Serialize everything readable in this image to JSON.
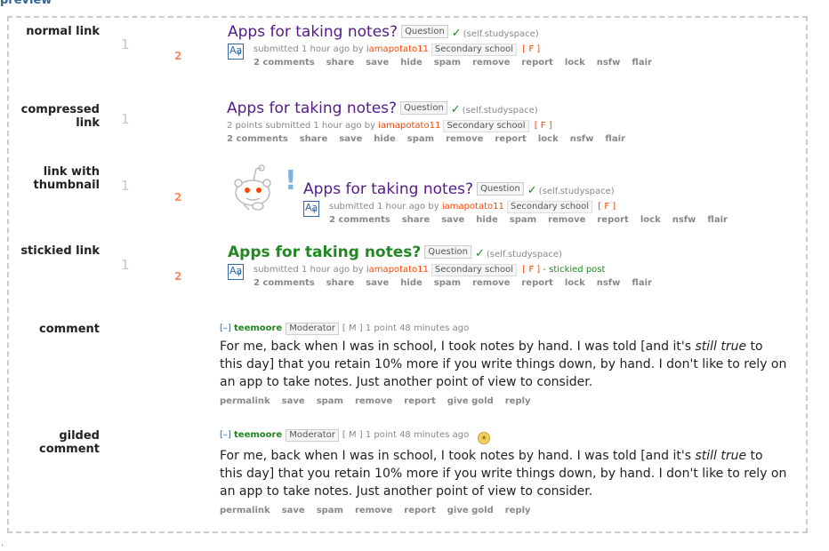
{
  "preview_heading": "preview",
  "post": {
    "title": "Apps for taking notes?",
    "flair": "Question",
    "check": "✓",
    "domain": "(self.studyspace)",
    "submitted_prefix": "submitted",
    "time": "1 hour ago",
    "by": "by",
    "author": "iamapotato11",
    "user_flair": "Secondary school",
    "f_box": "[ F ]",
    "points_prefix": "2 points submitted",
    "stickied_suffix": "- stickied post",
    "vote_a": "1",
    "vote_b": "2",
    "aa_icon": "Aa",
    "aa_plus": "+",
    "buttons": {
      "comments": "2 comments",
      "share": "share",
      "save": "save",
      "hide": "hide",
      "spam": "spam",
      "remove": "remove",
      "report": "report",
      "lock": "lock",
      "nsfw": "nsfw",
      "flair": "flair"
    },
    "exclaim": "!"
  },
  "rows": {
    "normal": "normal link",
    "compressed": "compressed link",
    "thumbnail": "link with thumbnail",
    "stickied": "stickied link",
    "comment": "comment",
    "gilded": "gilded comment"
  },
  "comment": {
    "toggle": "[–]",
    "author": "teemoore",
    "badge": "Moderator",
    "m_box": "[ M ]",
    "score": "1 point 48 minutes ago",
    "body_start": "For me, back when I was in school, I took notes by hand. I was told [and it's ",
    "body_italic": "still true",
    "body_end": " to this day] that you retain 10% more if you write things down, by hand. I don't like to rely on an app to take notes. Just another point of view to consider.",
    "buttons": {
      "permalink": "permalink",
      "save": "save",
      "spam": "spam",
      "remove": "remove",
      "report": "report",
      "give_gold": "give gold",
      "reply": "reply"
    }
  },
  "bottom_dot": "."
}
